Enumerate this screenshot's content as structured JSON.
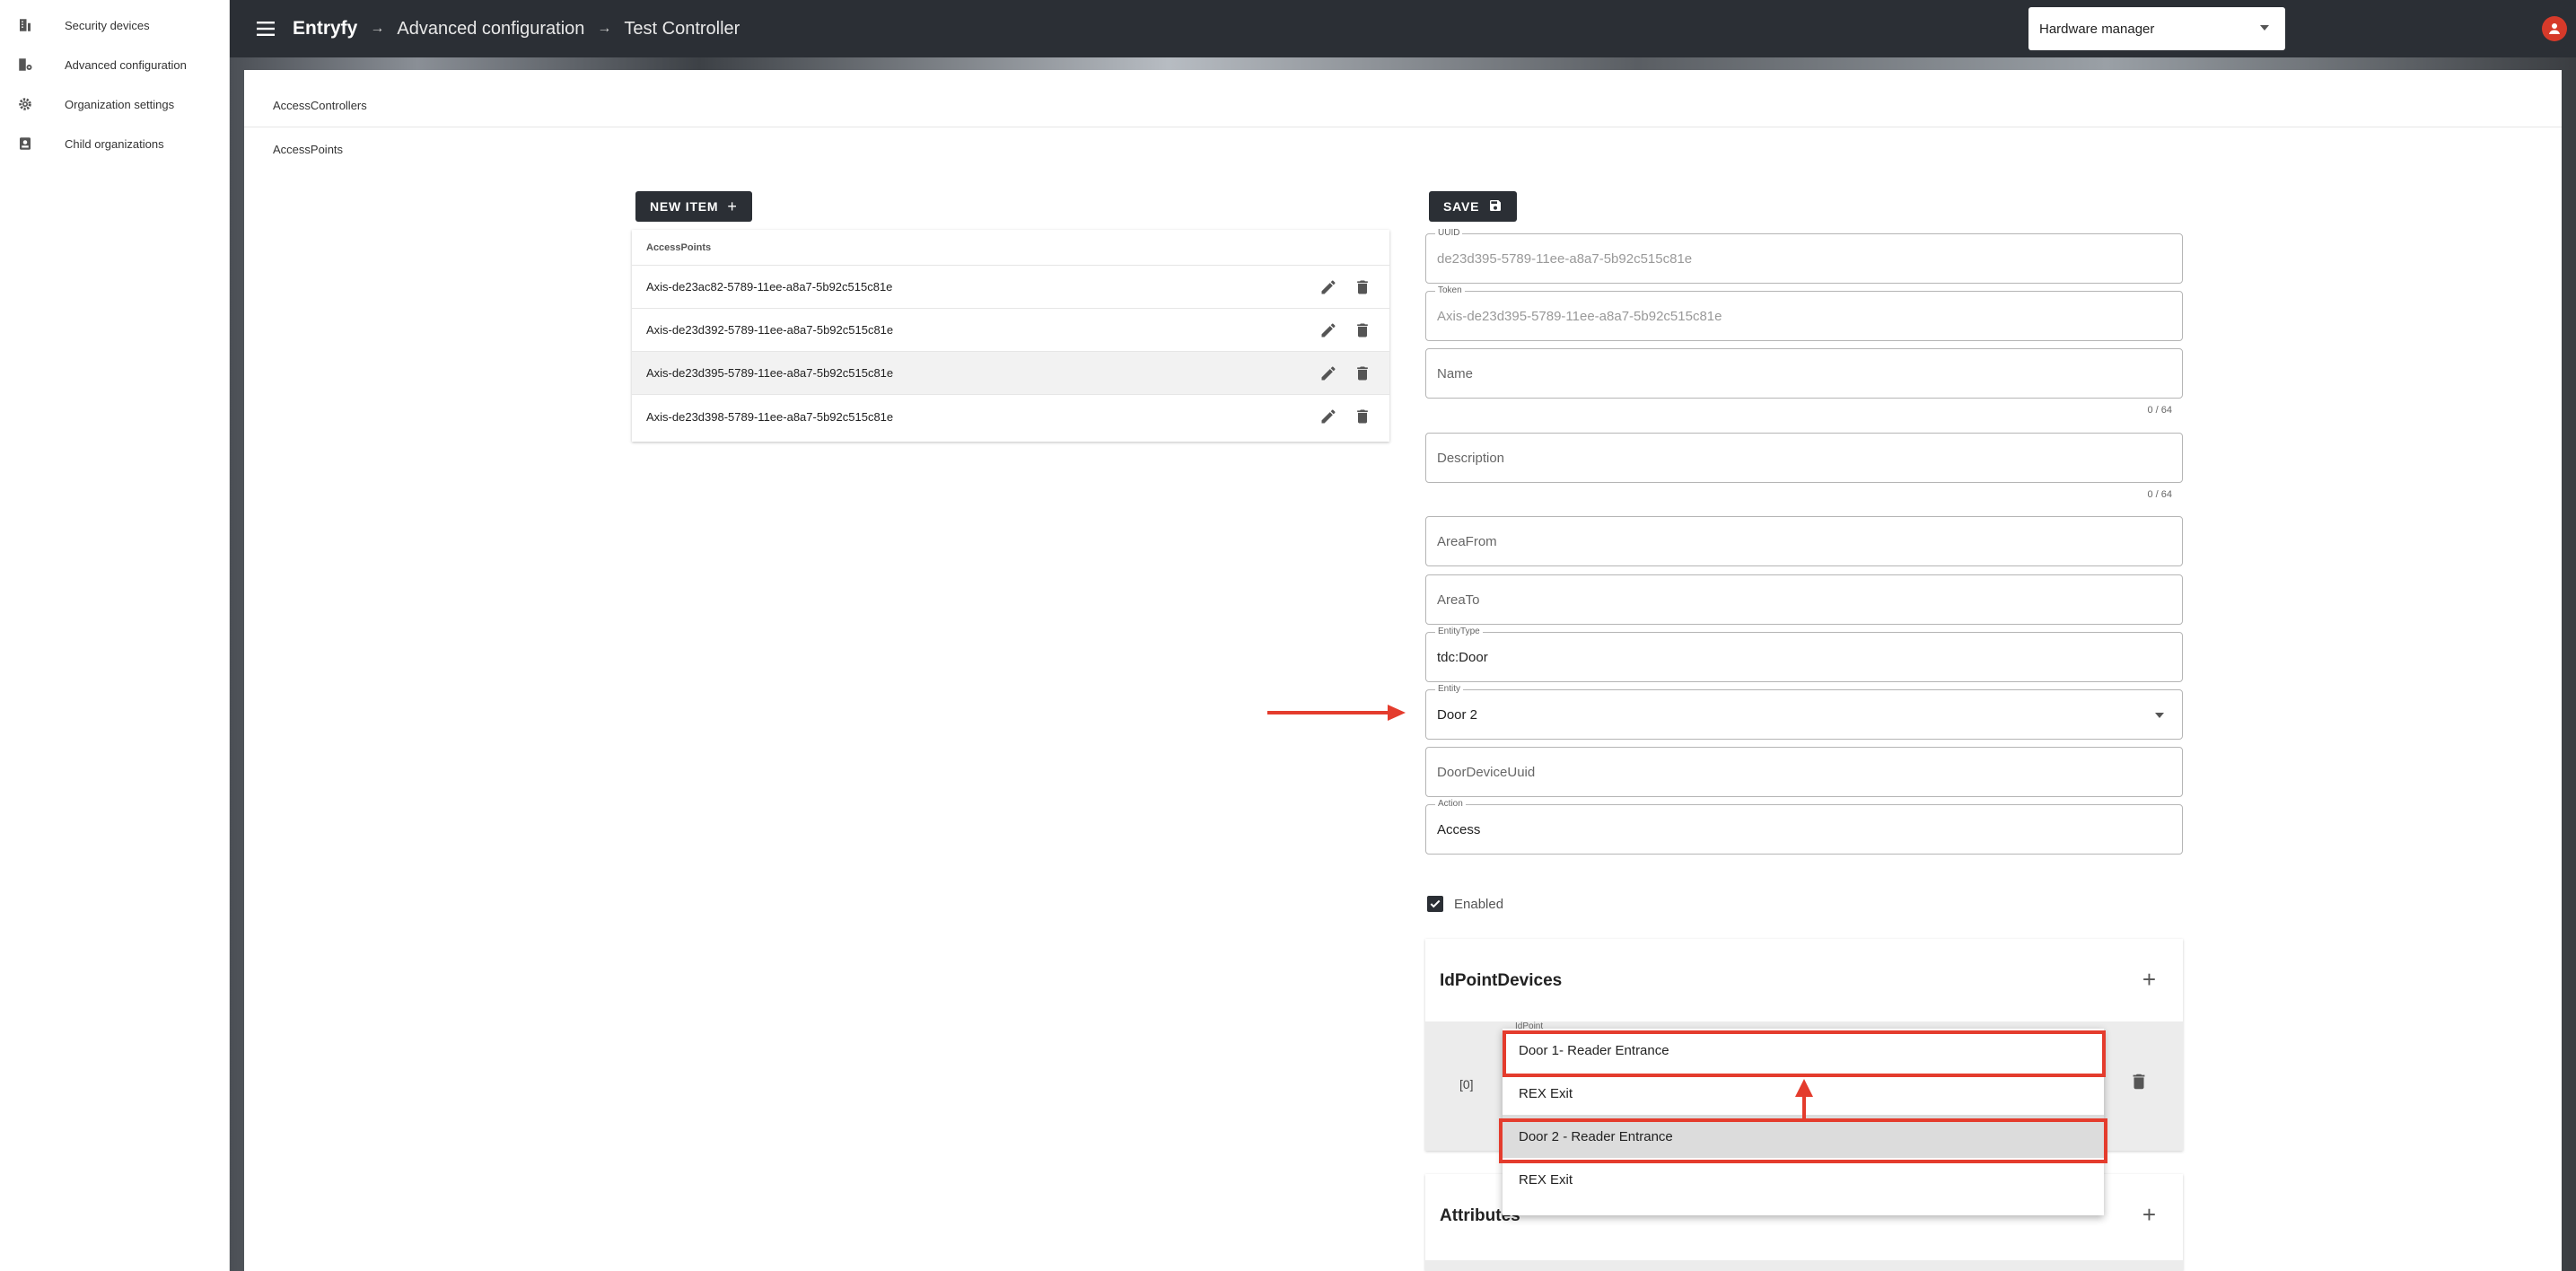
{
  "nav": {
    "items": [
      {
        "label": "Security devices",
        "icon": "building-icon"
      },
      {
        "label": "Advanced configuration",
        "icon": "settings-building-icon"
      },
      {
        "label": "Organization settings",
        "icon": "gear-icon"
      },
      {
        "label": "Child organizations",
        "icon": "badge-icon"
      }
    ]
  },
  "topbar": {
    "brand": "Entryfy",
    "crumb1": "Advanced configuration",
    "crumb2": "Test Controller",
    "separator": "→",
    "hardware_select": "Hardware manager"
  },
  "tabs": {
    "access_controllers": "AccessControllers",
    "access_points": "AccessPoints"
  },
  "list": {
    "new_item_label": "NEW ITEM",
    "header": "AccessPoints",
    "rows": [
      "Axis-de23ac82-5789-11ee-a8a7-5b92c515c81e",
      "Axis-de23d392-5789-11ee-a8a7-5b92c515c81e",
      "Axis-de23d395-5789-11ee-a8a7-5b92c515c81e",
      "Axis-de23d398-5789-11ee-a8a7-5b92c515c81e"
    ]
  },
  "form": {
    "save_label": "SAVE",
    "uuid": {
      "label": "UUID",
      "value": "de23d395-5789-11ee-a8a7-5b92c515c81e"
    },
    "token": {
      "label": "Token",
      "value": "Axis-de23d395-5789-11ee-a8a7-5b92c515c81e"
    },
    "name": {
      "placeholder": "Name",
      "counter": "0 / 64"
    },
    "description": {
      "placeholder": "Description",
      "counter": "0 / 64"
    },
    "area_from": {
      "placeholder": "AreaFrom"
    },
    "area_to": {
      "placeholder": "AreaTo"
    },
    "entity_type": {
      "label": "EntityType",
      "value": "tdc:Door"
    },
    "entity": {
      "label": "Entity",
      "value": "Door 2"
    },
    "door_device_uuid": {
      "placeholder": "DoorDeviceUuid"
    },
    "action": {
      "label": "Action",
      "value": "Access"
    },
    "enabled": {
      "label": "Enabled",
      "checked": true
    }
  },
  "id_point_devices": {
    "title": "IdPointDevices",
    "row_index": "[0]",
    "field_label": "IdPoint"
  },
  "attributes": {
    "title": "Attributes"
  },
  "dropdown": {
    "options": [
      "Door 1- Reader Entrance",
      "REX Exit",
      "Door 2 - Reader Entrance",
      "REX Exit"
    ]
  },
  "colors": {
    "topbar": "#2b2f35",
    "accent_red": "#e43c2d",
    "avatar": "#d63a2a"
  }
}
